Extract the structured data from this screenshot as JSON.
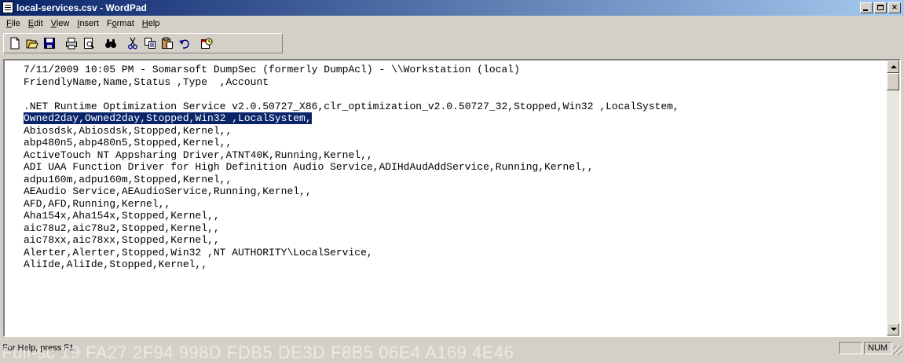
{
  "window": {
    "title": "local-services.csv - WordPad"
  },
  "menu": [
    {
      "key": "F",
      "rest": "ile"
    },
    {
      "key": "E",
      "rest": "dit"
    },
    {
      "key": "V",
      "rest": "iew"
    },
    {
      "key": "I",
      "rest": "nsert"
    },
    {
      "pre": "F",
      "key": "o",
      "rest": "rmat"
    },
    {
      "key": "H",
      "rest": "elp"
    }
  ],
  "document": {
    "lines": [
      "7/11/2009 10:05 PM - Somarsoft DumpSec (formerly DumpAcl) - \\\\Workstation (local)",
      "FriendlyName,Name,Status ,Type  ,Account",
      "",
      ".NET Runtime Optimization Service v2.0.50727_X86,clr_optimization_v2.0.50727_32,Stopped,Win32 ,LocalSystem,",
      "Owned2day,Owned2day,Stopped,Win32 ,LocalSystem,",
      "Abiosdsk,Abiosdsk,Stopped,Kernel,,",
      "abp480n5,abp480n5,Stopped,Kernel,,",
      "ActiveTouch NT Appsharing Driver,ATNT40K,Running,Kernel,,",
      "ADI UAA Function Driver for High Definition Audio Service,ADIHdAudAddService,Running,Kernel,,",
      "adpu160m,adpu160m,Stopped,Kernel,,",
      "AEAudio Service,AEAudioService,Running,Kernel,,",
      "AFD,AFD,Running,Kernel,,",
      "Aha154x,Aha154x,Stopped,Kernel,,",
      "aic78u2,aic78u2,Stopped,Kernel,,",
      "aic78xx,aic78xx,Stopped,Kernel,,",
      "Alerter,Alerter,Stopped,Win32 ,NT AUTHORITY\\LocalService,",
      "AliIde,AliIde,Stopped,Kernel,,"
    ],
    "selected_line": 4
  },
  "status": {
    "help": "For Help, press F1",
    "num": "NUM"
  },
  "watermark": "Full-sc 19 FA27 2F94 998D FDB5 DE3D F8B5 06E4 A169 4E46",
  "colors": {
    "selection": "#0a246a",
    "titlebar": "#0a246a"
  }
}
